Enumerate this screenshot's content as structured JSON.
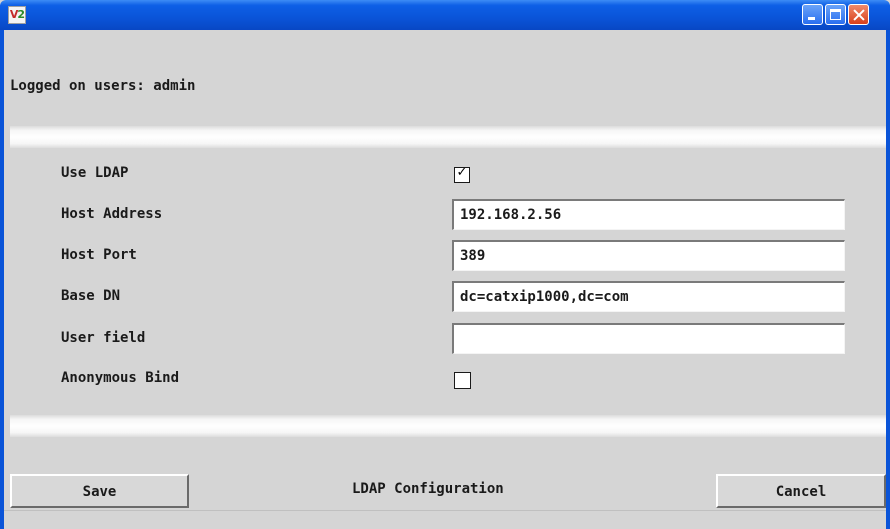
{
  "window": {
    "title": "",
    "app_icon_text_v": "V",
    "app_icon_text_2": "2",
    "accent_color": "#0a54d8"
  },
  "header": {
    "logged_users": "Logged on users:  admin"
  },
  "form": {
    "use_ldap_label": "Use LDAP",
    "use_ldap_checked": true,
    "use_ldap_mark": "✓",
    "host_address_label": "Host Address",
    "host_address_value": "192.168.2.56",
    "host_port_label": "Host Port",
    "host_port_value": "389",
    "base_dn_label": "Base DN",
    "base_dn_value": "dc=catxip1000,dc=com",
    "user_field_label": "User field",
    "user_field_value": "",
    "anonymous_bind_label": "Anonymous Bind",
    "anonymous_bind_checked": false
  },
  "footer": {
    "save_label": "Save",
    "title": "LDAP Configuration",
    "cancel_label": "Cancel"
  }
}
